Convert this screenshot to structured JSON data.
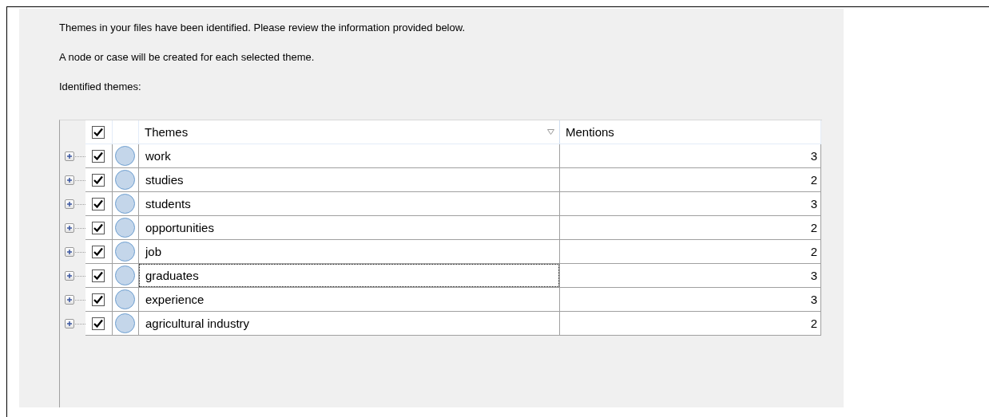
{
  "intro": [
    "Themes in your files have been identified. Please review the information provided below.",
    "A node or case will be created for each selected theme.",
    "Identified themes:"
  ],
  "table": {
    "all_checked": true,
    "columns": [
      "Themes",
      "Mentions"
    ],
    "rows": [
      {
        "theme": "work",
        "mentions": "3",
        "checked": true,
        "expanded": false,
        "focused": false
      },
      {
        "theme": "studies",
        "mentions": "2",
        "checked": true,
        "expanded": false,
        "focused": false
      },
      {
        "theme": "students",
        "mentions": "3",
        "checked": true,
        "expanded": false,
        "focused": false
      },
      {
        "theme": "opportunities",
        "mentions": "2",
        "checked": true,
        "expanded": false,
        "focused": false
      },
      {
        "theme": "job",
        "mentions": "2",
        "checked": true,
        "expanded": false,
        "focused": false
      },
      {
        "theme": "graduates",
        "mentions": "3",
        "checked": true,
        "expanded": false,
        "focused": true
      },
      {
        "theme": "experience",
        "mentions": "3",
        "checked": true,
        "expanded": false,
        "focused": false
      },
      {
        "theme": "agricultural industry",
        "mentions": "2",
        "checked": true,
        "expanded": false,
        "focused": false
      }
    ]
  }
}
